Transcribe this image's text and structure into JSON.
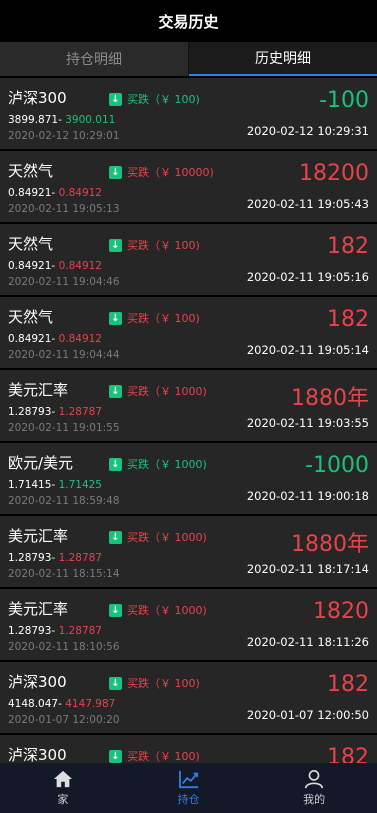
{
  "header": {
    "title": "交易历史"
  },
  "tabs": [
    {
      "label": "持仓明细",
      "active": false
    },
    {
      "label": "历史明细",
      "active": true
    }
  ],
  "records": [
    {
      "name": "泸深300",
      "direction": "买跌（￥ 100)",
      "direction_color": "green",
      "open_price": "3899.871",
      "close_price": "3900.011",
      "close_color": "green",
      "open_time": "2020-02-12 10:29:01",
      "amount": "-100",
      "amount_color": "green",
      "close_time": "2020-02-12 10:29:31"
    },
    {
      "name": "天然气",
      "direction": "买跌（￥ 10000)",
      "direction_color": "red",
      "open_price": "0.84921",
      "close_price": "0.84912",
      "close_color": "red",
      "open_time": "2020-02-11 19:05:13",
      "amount": "18200",
      "amount_color": "red",
      "close_time": "2020-02-11 19:05:43"
    },
    {
      "name": "天然气",
      "direction": "买跌（￥ 100)",
      "direction_color": "red",
      "open_price": "0.84921",
      "close_price": "0.84912",
      "close_color": "red",
      "open_time": "2020-02-11 19:04:46",
      "amount": "182",
      "amount_color": "red",
      "close_time": "2020-02-11 19:05:16"
    },
    {
      "name": "天然气",
      "direction": "买跌（￥ 100)",
      "direction_color": "red",
      "open_price": "0.84921",
      "close_price": "0.84912",
      "close_color": "red",
      "open_time": "2020-02-11 19:04:44",
      "amount": "182",
      "amount_color": "red",
      "close_time": "2020-02-11 19:05:14"
    },
    {
      "name": "美元汇率",
      "direction": "买跌（￥ 1000)",
      "direction_color": "red",
      "open_price": "1.28793",
      "close_price": "1.28787",
      "close_color": "red",
      "open_time": "2020-02-11 19:01:55",
      "amount": "1880年",
      "amount_color": "red",
      "close_time": "2020-02-11 19:03:55"
    },
    {
      "name": "欧元/美元",
      "direction": "买跌（￥ 1000)",
      "direction_color": "green",
      "open_price": "1.71415",
      "close_price": "1.71425",
      "close_color": "green",
      "open_time": "2020-02-11 18:59:48",
      "amount": "-1000",
      "amount_color": "green",
      "close_time": "2020-02-11 19:00:18"
    },
    {
      "name": "美元汇率",
      "direction": "买跌（￥ 1000)",
      "direction_color": "red",
      "open_price": "1.28793",
      "close_price": "1.28787",
      "close_color": "red",
      "open_time": "2020-02-11 18:15:14",
      "amount": "1880年",
      "amount_color": "red",
      "close_time": "2020-02-11 18:17:14"
    },
    {
      "name": "美元汇率",
      "direction": "买跌（￥ 1000)",
      "direction_color": "red",
      "open_price": "1.28793",
      "close_price": "1.28787",
      "close_color": "red",
      "open_time": "2020-02-11 18:10:56",
      "amount": "1820",
      "amount_color": "red",
      "close_time": "2020-02-11 18:11:26"
    },
    {
      "name": "泸深300",
      "direction": "买跌（￥ 100)",
      "direction_color": "red",
      "open_price": "4148.047",
      "close_price": "4147.987",
      "close_color": "red",
      "open_time": "2020-01-07 12:00:20",
      "amount": "182",
      "amount_color": "red",
      "close_time": "2020-01-07 12:00:50"
    },
    {
      "name": "泸深300",
      "direction": "买跌（￥ 100)",
      "direction_color": "red",
      "open_price": "",
      "close_price": "",
      "close_color": "red",
      "open_time": "",
      "amount": "182",
      "amount_color": "red",
      "close_time": ""
    }
  ],
  "nav": [
    {
      "label": "家",
      "icon": "home-icon",
      "active": false
    },
    {
      "label": "持仓",
      "icon": "chart-icon",
      "active": true
    },
    {
      "label": "我的",
      "icon": "user-icon",
      "active": false
    }
  ],
  "colors": {
    "green": "#19c37d",
    "red": "#e8424b",
    "accent": "#2e7ee6"
  }
}
